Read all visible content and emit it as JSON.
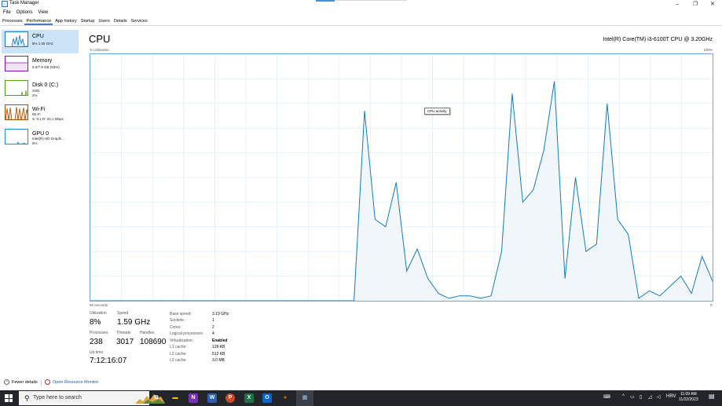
{
  "window": {
    "title": "Task Manager",
    "buttons": {
      "minimize": "–",
      "restore": "❐",
      "close": "✕"
    }
  },
  "menu": [
    "File",
    "Options",
    "View"
  ],
  "tabs": [
    "Processes",
    "Performance",
    "App history",
    "Startup",
    "Users",
    "Details",
    "Services"
  ],
  "active_tab": "Performance",
  "sidebar": [
    {
      "name": "CPU",
      "sub": [
        "8%  1.59 GHz"
      ],
      "color": "#117dbb",
      "selected": true
    },
    {
      "name": "Memory",
      "sub": [
        "5.0/7.9 GB (63%)"
      ],
      "color": "#8b12ae",
      "selected": false
    },
    {
      "name": "Disk 0 (C:)",
      "sub": [
        "SSD",
        "2%"
      ],
      "color": "#4da60c",
      "selected": false
    },
    {
      "name": "Wi-Fi",
      "sub": [
        "Wi-Fi",
        "S: 0.1  R: 34.1 Mbps"
      ],
      "color": "#a74f01",
      "selected": false
    },
    {
      "name": "GPU 0",
      "sub": [
        "Intel(R) HD Graphi...",
        "5%"
      ],
      "color": "#1d8fc9",
      "selected": false
    }
  ],
  "main": {
    "title": "CPU",
    "model": "Intel(R) Core(TM) i3-6100T CPU @ 3.20GHz",
    "utilization_label": "% Utilization",
    "max_label": "100%",
    "seconds_label": "60 seconds",
    "min_label": "0",
    "tooltip": "CPU activity",
    "graph_color": "#117dbb",
    "graph_fill": "#f1f6fa",
    "grid_color": "#d9eaf7"
  },
  "chart_data": {
    "type": "area",
    "x_range": [
      60,
      0
    ],
    "ylim": [
      0,
      100
    ],
    "grid": true,
    "values": [
      0,
      0,
      0,
      0,
      0,
      0,
      0,
      0,
      0,
      0,
      0,
      0,
      0,
      0,
      0,
      0,
      0,
      0,
      0,
      0,
      0,
      0,
      0,
      0,
      0,
      0,
      77,
      33,
      30,
      48,
      12,
      21,
      9,
      3,
      1,
      2,
      2,
      1,
      2,
      20,
      84,
      40,
      45,
      61,
      89,
      9,
      50,
      20,
      23,
      80,
      33,
      27,
      1,
      4,
      2,
      6,
      10,
      3,
      18,
      8
    ]
  },
  "stats": {
    "utilization": {
      "label": "Utilization",
      "value": "8%"
    },
    "speed": {
      "label": "Speed",
      "value": "1.59 GHz"
    },
    "processes": {
      "label": "Processes",
      "value": "238"
    },
    "threads": {
      "label": "Threads",
      "value": "3017"
    },
    "handles": {
      "label": "Handles",
      "value": "108690"
    },
    "uptime": {
      "label": "Up time",
      "value": "7:12:16:07"
    }
  },
  "specs": [
    {
      "label": "Base speed:",
      "value": "3.19 GHz"
    },
    {
      "label": "Sockets:",
      "value": "1"
    },
    {
      "label": "Cores:",
      "value": "2"
    },
    {
      "label": "Logical processors:",
      "value": "4"
    },
    {
      "label": "Virtualization:",
      "value": "Enabled",
      "bold": true
    },
    {
      "label": "L1 cache:",
      "value": "128 KB"
    },
    {
      "label": "L2 cache:",
      "value": "512 KB"
    },
    {
      "label": "L3 cache:",
      "value": "3.0 MB"
    }
  ],
  "footer": {
    "fewer_details": "Fewer details",
    "resource_monitor": "Open Resource Monitor"
  },
  "taskbar": {
    "search_placeholder": "Type here to search",
    "apps": [
      {
        "name": "task-view-icon",
        "glyph": "⧉",
        "color": "#22252a"
      },
      {
        "name": "file-explorer-icon",
        "glyph": "▬",
        "color": "#f2c200"
      },
      {
        "name": "onenote-icon",
        "glyph": "N",
        "color": "#7b2fb5"
      },
      {
        "name": "word-icon",
        "glyph": "W",
        "color": "#2b5fb4"
      },
      {
        "name": "powerpoint-icon",
        "glyph": "P",
        "color": "#d24726"
      },
      {
        "name": "excel-icon",
        "glyph": "X",
        "color": "#1e7145"
      },
      {
        "name": "outlook-icon",
        "glyph": "O",
        "color": "#0a64c8"
      },
      {
        "name": "firefox-icon",
        "glyph": "●",
        "color": "#e66000"
      },
      {
        "name": "task-manager-icon",
        "glyph": "▦",
        "color": "#5a7ea8"
      }
    ],
    "tray": {
      "lang": "HRV",
      "time": "11:09 AM",
      "date": "11/22/2023"
    }
  }
}
